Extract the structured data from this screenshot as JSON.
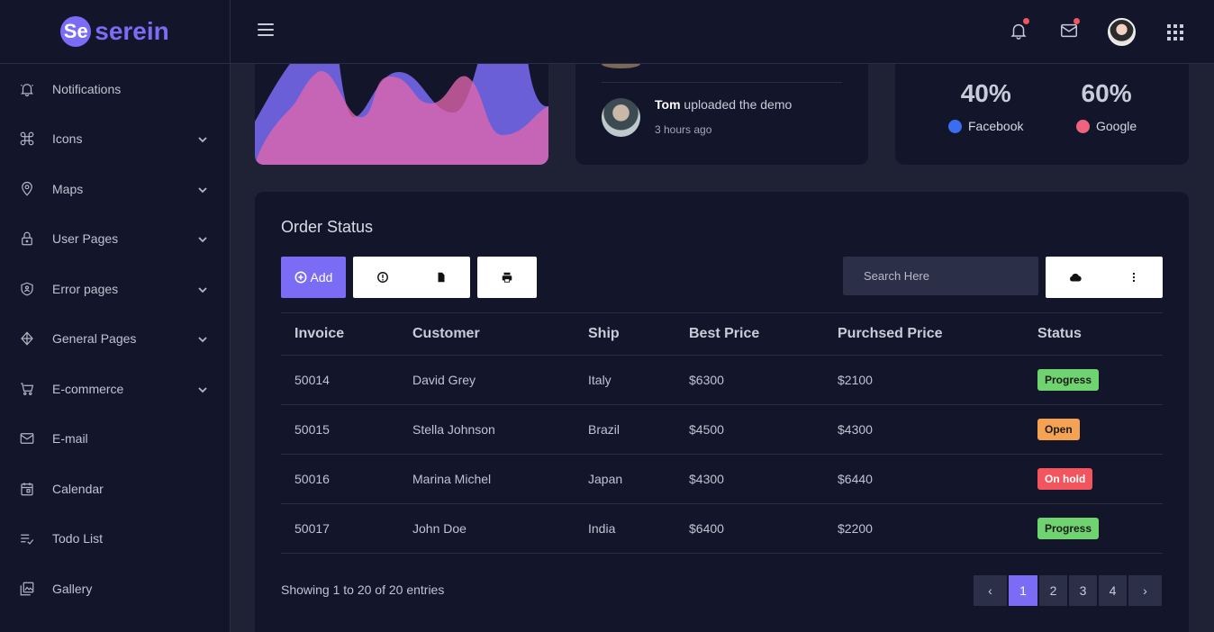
{
  "brand": {
    "mark": "Se",
    "name": "serein",
    "accent": "#7b6cf6"
  },
  "sidebar": {
    "items": [
      {
        "label": "Notifications",
        "icon": "bell-icon",
        "expandable": false
      },
      {
        "label": "Icons",
        "icon": "command-icon",
        "expandable": true
      },
      {
        "label": "Maps",
        "icon": "map-pin-icon",
        "expandable": true
      },
      {
        "label": "User Pages",
        "icon": "lock-icon",
        "expandable": true
      },
      {
        "label": "Error pages",
        "icon": "shield-icon",
        "expandable": true
      },
      {
        "label": "General Pages",
        "icon": "cube-icon",
        "expandable": true
      },
      {
        "label": "E-commerce",
        "icon": "cart-icon",
        "expandable": true
      },
      {
        "label": "E-mail",
        "icon": "mail-icon",
        "expandable": false
      },
      {
        "label": "Calendar",
        "icon": "calendar-icon",
        "expandable": false
      },
      {
        "label": "Todo List",
        "icon": "checklist-icon",
        "expandable": false
      },
      {
        "label": "Gallery",
        "icon": "gallery-icon",
        "expandable": false
      }
    ]
  },
  "activity": {
    "name": "Tom",
    "action": "uploaded the demo",
    "time": "3 hours ago"
  },
  "social": [
    {
      "value": "40%",
      "label": "Facebook",
      "color": "#3a6df0"
    },
    {
      "value": "60%",
      "label": "Google",
      "color": "#f0637e"
    }
  ],
  "order": {
    "title": "Order Status",
    "add_label": "Add",
    "search_placeholder": "Search Here",
    "columns": [
      "Invoice",
      "Customer",
      "Ship",
      "Best Price",
      "Purchsed Price",
      "Status"
    ],
    "rows": [
      {
        "invoice": "50014",
        "customer": "David Grey",
        "ship": "Italy",
        "best": "$6300",
        "purchased": "$2100",
        "status": "Progress",
        "status_color": "#6fd36f"
      },
      {
        "invoice": "50015",
        "customer": "Stella Johnson",
        "ship": "Brazil",
        "best": "$4500",
        "purchased": "$4300",
        "status": "Open",
        "status_color": "#f5a352"
      },
      {
        "invoice": "50016",
        "customer": "Marina Michel",
        "ship": "Japan",
        "best": "$4300",
        "purchased": "$6440",
        "status": "On hold",
        "status_color": "#f2555d"
      },
      {
        "invoice": "50017",
        "customer": "John Doe",
        "ship": "India",
        "best": "$6400",
        "purchased": "$2200",
        "status": "Progress",
        "status_color": "#6fd36f"
      }
    ],
    "showing": "Showing 1 to 20 of 20 entries",
    "pages": [
      "‹",
      "1",
      "2",
      "3",
      "4",
      "›"
    ],
    "active_page": "1"
  }
}
